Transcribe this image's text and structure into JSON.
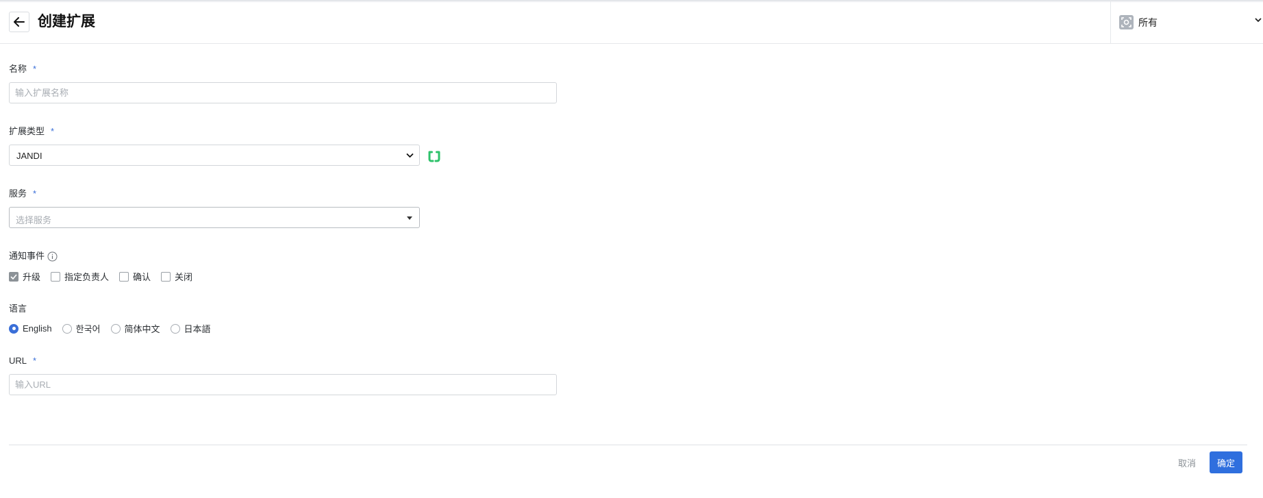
{
  "header": {
    "title": "创建扩展",
    "scope_label": "所有"
  },
  "form": {
    "name": {
      "label": "名称",
      "required_mark": "*",
      "placeholder": "输入扩展名称",
      "value": ""
    },
    "extension_type": {
      "label": "扩展类型",
      "required_mark": "*",
      "selected": "JANDI",
      "brand_icon": "jandi-logo-icon",
      "brand_color": "#2ec26b"
    },
    "service": {
      "label": "服务",
      "required_mark": "*",
      "placeholder": "选择服务"
    },
    "notify_events": {
      "label": "通知事件",
      "options": [
        {
          "label": "升级",
          "checked": true
        },
        {
          "label": "指定负责人",
          "checked": false
        },
        {
          "label": "确认",
          "checked": false
        },
        {
          "label": "关闭",
          "checked": false
        }
      ]
    },
    "language": {
      "label": "语言",
      "options": [
        {
          "label": "English",
          "selected": true
        },
        {
          "label": "한국어",
          "selected": false
        },
        {
          "label": "简体中文",
          "selected": false
        },
        {
          "label": "日本語",
          "selected": false
        }
      ]
    },
    "url": {
      "label": "URL",
      "required_mark": "*",
      "placeholder": "输入URL",
      "value": ""
    }
  },
  "footer": {
    "cancel_label": "取消",
    "confirm_label": "确定"
  },
  "colors": {
    "accent": "#2f6fde",
    "required": "#3a6fd8"
  }
}
